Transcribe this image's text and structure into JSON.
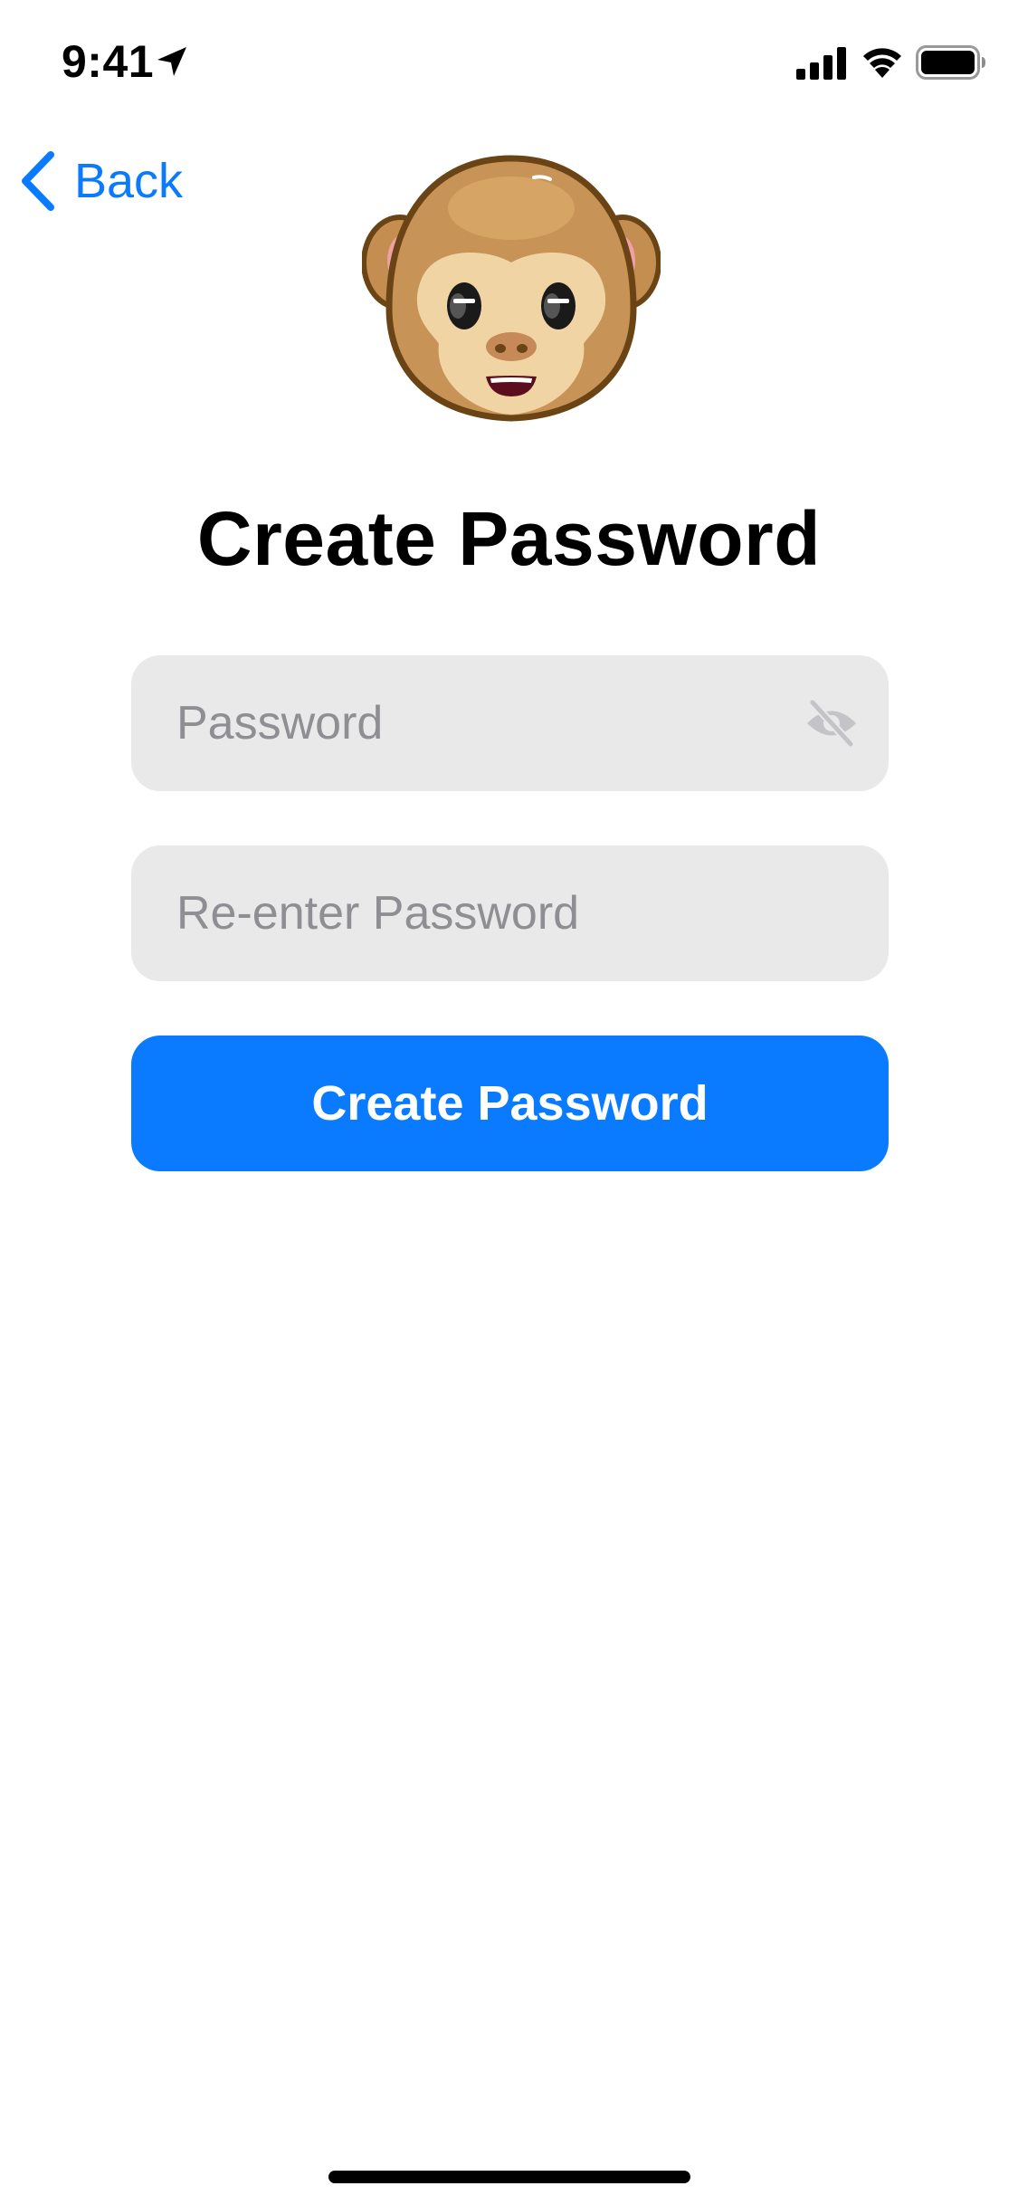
{
  "status_bar": {
    "time": "9:41",
    "icons": [
      "location-arrow-icon",
      "cellular-signal-icon",
      "wifi-icon",
      "battery-icon"
    ]
  },
  "nav": {
    "back_label": "Back",
    "back_icon": "chevron-left-icon"
  },
  "hero": {
    "image": "monkey-face-emoji"
  },
  "title": "Create Password",
  "form": {
    "password_placeholder": "Password",
    "password_value": "",
    "visibility_icon": "eye-slash-icon",
    "reenter_placeholder": "Re-enter Password",
    "reenter_value": "",
    "submit_label": "Create Password"
  },
  "colors": {
    "accent": "#0A7AFF",
    "field_background": "#E9E9EA",
    "placeholder": "#8E8E93",
    "background": "#FFFFFF"
  }
}
